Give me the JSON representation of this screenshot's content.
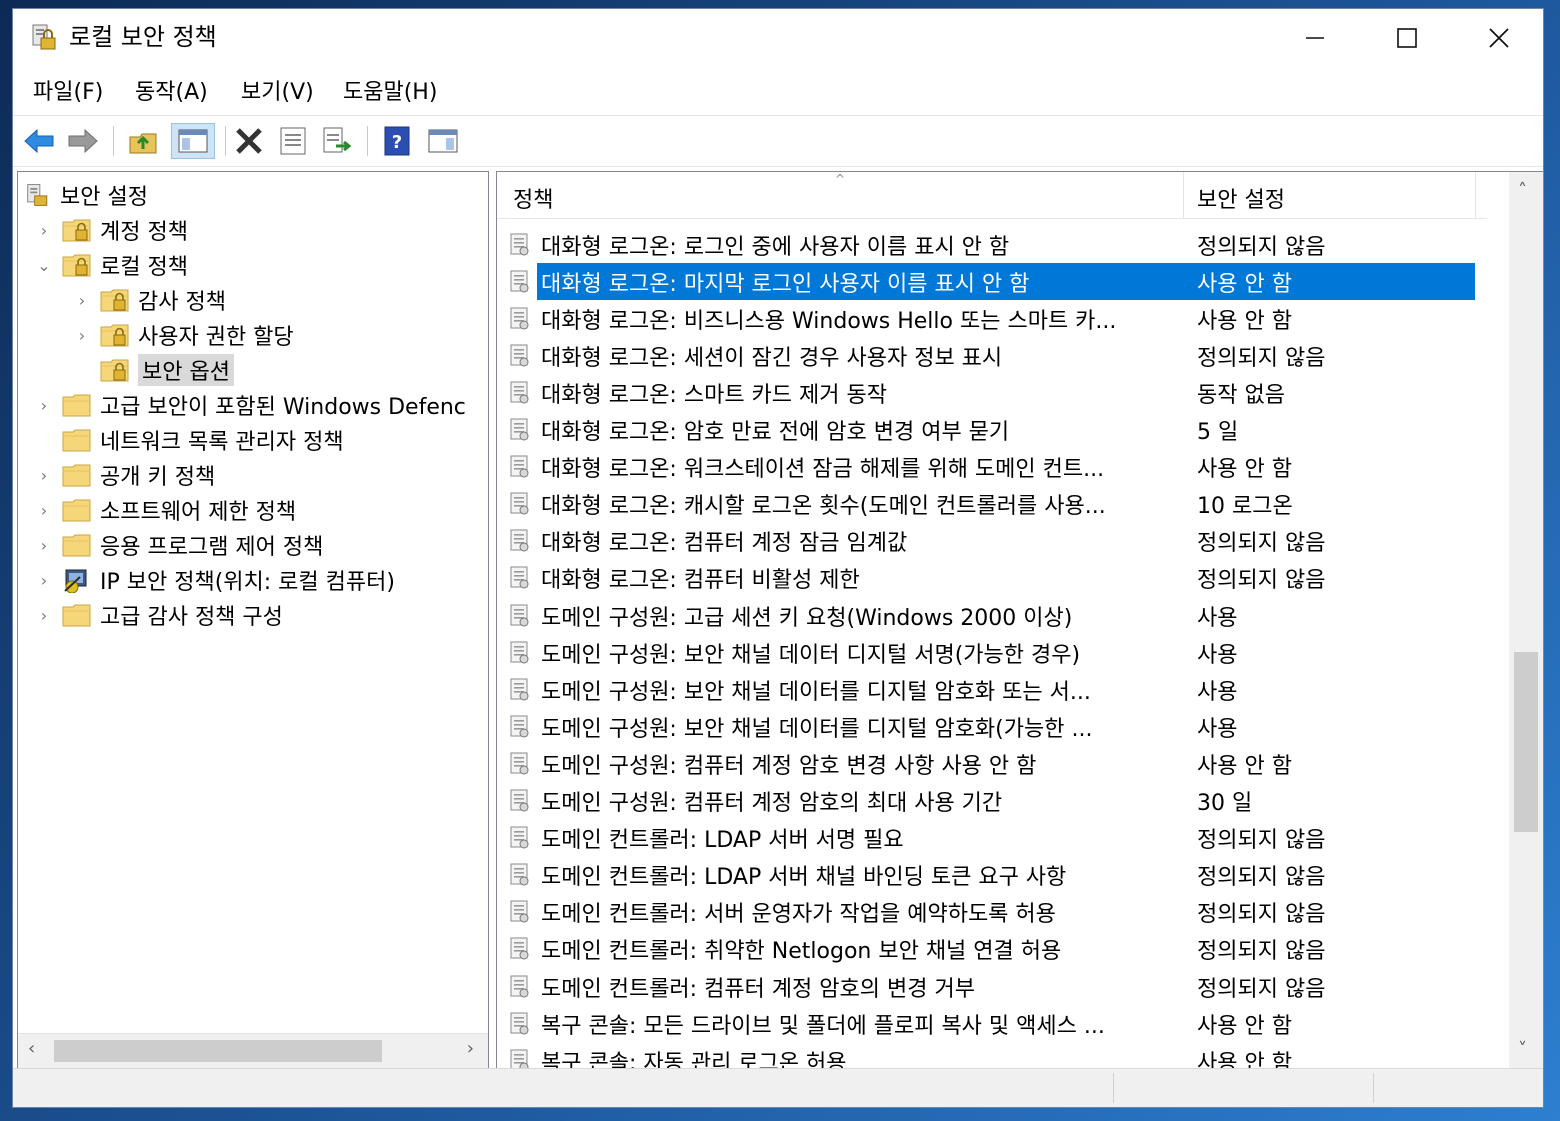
{
  "window": {
    "title": "로컬 보안 정책",
    "minimize": "—",
    "maximize": "☐",
    "close": "✕"
  },
  "menu": [
    "파일(F)",
    "동작(A)",
    "보기(V)",
    "도움말(H)"
  ],
  "toolbar": {
    "icons": [
      "back-arrow-icon",
      "forward-arrow-icon",
      "up-folder-icon",
      "show-hide-tree-icon",
      "delete-icon",
      "properties-icon",
      "export-list-icon",
      "help-icon",
      "show-hide-action-pane-icon"
    ]
  },
  "tree": {
    "root": "보안 설정",
    "items": [
      {
        "label": "계정 정책",
        "level": 1,
        "expander": "›"
      },
      {
        "label": "로컬 정책",
        "level": 1,
        "expander": "⌄"
      },
      {
        "label": "감사 정책",
        "level": 2,
        "expander": "›"
      },
      {
        "label": "사용자 권한 할당",
        "level": 2,
        "expander": "›"
      },
      {
        "label": "보안 옵션",
        "level": 2,
        "expander": "",
        "selected": true
      },
      {
        "label": "고급 보안이 포함된 Windows Defenc",
        "level": 1,
        "expander": "›"
      },
      {
        "label": "네트워크 목록 관리자 정책",
        "level": 1,
        "expander": ""
      },
      {
        "label": "공개 키 정책",
        "level": 1,
        "expander": "›"
      },
      {
        "label": "소프트웨어 제한 정책",
        "level": 1,
        "expander": "›"
      },
      {
        "label": "응용 프로그램 제어 정책",
        "level": 1,
        "expander": "›"
      },
      {
        "label": "IP 보안 정책(위치: 로컬 컴퓨터)",
        "level": 1,
        "expander": "›"
      },
      {
        "label": "고급 감사 정책 구성",
        "level": 1,
        "expander": "›"
      }
    ]
  },
  "list": {
    "columns": {
      "policy": "정책",
      "setting": "보안 설정"
    },
    "rows": [
      {
        "policy": "대화형 로그온: 로그인 중에 사용자 이름 표시 안 함",
        "setting": "정의되지 않음"
      },
      {
        "policy": "대화형 로그온: 마지막 로그인 사용자 이름 표시 안 함",
        "setting": "사용 안 함",
        "selected": true
      },
      {
        "policy": "대화형 로그온: 비즈니스용 Windows Hello 또는 스마트 카...",
        "setting": "사용 안 함"
      },
      {
        "policy": "대화형 로그온: 세션이 잠긴 경우 사용자 정보 표시",
        "setting": "정의되지 않음"
      },
      {
        "policy": "대화형 로그온: 스마트 카드 제거 동작",
        "setting": "동작 없음"
      },
      {
        "policy": "대화형 로그온: 암호 만료 전에 암호 변경 여부 묻기",
        "setting": "5 일"
      },
      {
        "policy": "대화형 로그온: 워크스테이션 잠금 해제를 위해 도메인 컨트...",
        "setting": "사용 안 함"
      },
      {
        "policy": "대화형 로그온: 캐시할 로그온 횟수(도메인 컨트롤러를 사용...",
        "setting": "10 로그온"
      },
      {
        "policy": "대화형 로그온: 컴퓨터 계정 잠금 임계값",
        "setting": "정의되지 않음"
      },
      {
        "policy": "대화형 로그온: 컴퓨터 비활성 제한",
        "setting": "정의되지 않음"
      },
      {
        "policy": "도메인 구성원: 고급 세션 키 요청(Windows 2000 이상)",
        "setting": "사용"
      },
      {
        "policy": "도메인 구성원: 보안 채널 데이터 디지털 서명(가능한 경우)",
        "setting": "사용"
      },
      {
        "policy": "도메인 구성원: 보안 채널 데이터를 디지털 암호화 또는 서...",
        "setting": "사용"
      },
      {
        "policy": "도메인 구성원: 보안 채널 데이터를 디지털 암호화(가능한 ...",
        "setting": "사용"
      },
      {
        "policy": "도메인 구성원: 컴퓨터 계정 암호 변경 사항 사용 안 함",
        "setting": "사용 안 함"
      },
      {
        "policy": "도메인 구성원: 컴퓨터 계정 암호의 최대 사용 기간",
        "setting": "30 일"
      },
      {
        "policy": "도메인 컨트롤러: LDAP 서버 서명 필요",
        "setting": "정의되지 않음"
      },
      {
        "policy": "도메인 컨트롤러: LDAP 서버 채널 바인딩 토큰 요구 사항",
        "setting": "정의되지 않음"
      },
      {
        "policy": "도메인 컨트롤러: 서버 운영자가 작업을 예약하도록 허용",
        "setting": "정의되지 않음"
      },
      {
        "policy": "도메인 컨트롤러: 취약한 Netlogon 보안 채널 연결 허용",
        "setting": "정의되지 않음"
      },
      {
        "policy": "도메인 컨트롤러: 컴퓨터 계정 암호의 변경 거부",
        "setting": "정의되지 않음"
      },
      {
        "policy": "복구 콘솔: 모든 드라이브 및 폴더에 플로피 복사 및 액세스 ...",
        "setting": "사용 안 함"
      },
      {
        "policy": "복구 콘솔: 자동 관리 로그온 허용",
        "setting": "사용 안 함"
      }
    ]
  },
  "colors": {
    "selection": "#0078d7",
    "tree_selection": "#d9d9d9",
    "folder": "#f5d77a"
  }
}
